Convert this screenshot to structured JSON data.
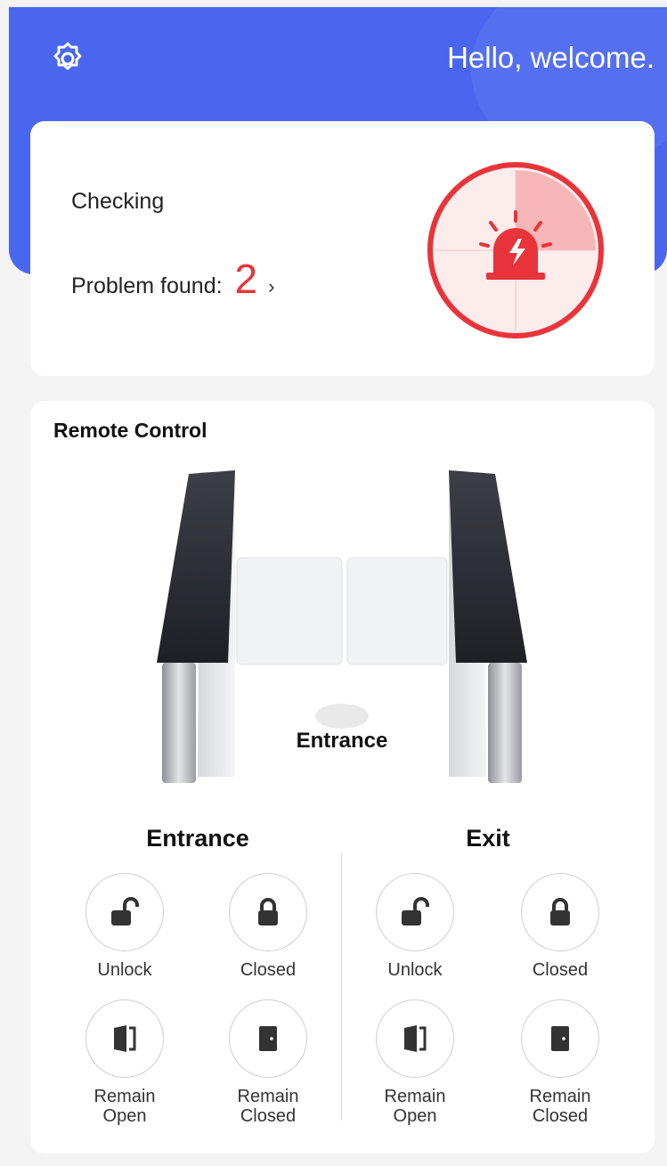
{
  "header": {
    "greeting": "Hello, welcome."
  },
  "status": {
    "checking_label": "Checking",
    "problem_label": "Problem found:",
    "problem_count": "2",
    "problem_chevron": "›"
  },
  "remote": {
    "title": "Remote Control",
    "gate_caption": "Entrance",
    "columns": [
      {
        "title": "Entrance",
        "controls": [
          {
            "label": "Unlock",
            "icon": "unlock-icon"
          },
          {
            "label": "Closed",
            "icon": "lock-icon"
          },
          {
            "label": "Remain\nOpen",
            "icon": "door-open-icon"
          },
          {
            "label": "Remain\nClosed",
            "icon": "door-closed-icon"
          }
        ]
      },
      {
        "title": "Exit",
        "controls": [
          {
            "label": "Unlock",
            "icon": "unlock-icon"
          },
          {
            "label": "Closed",
            "icon": "lock-icon"
          },
          {
            "label": "Remain\nOpen",
            "icon": "door-open-icon"
          },
          {
            "label": "Remain\nClosed",
            "icon": "door-closed-icon"
          }
        ]
      }
    ]
  },
  "colors": {
    "brand": "#4a66ee",
    "alert": "#e8343a"
  }
}
